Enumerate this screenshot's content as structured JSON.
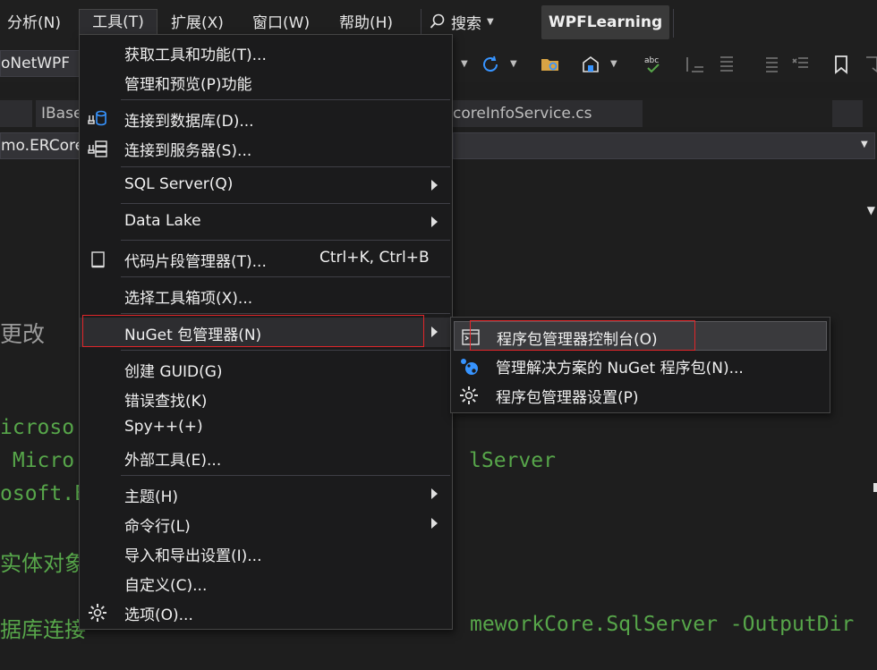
{
  "menubar": {
    "items": [
      "分析(N)",
      "工具(T)",
      "扩展(X)",
      "窗口(W)",
      "帮助(H)"
    ],
    "search_label": "搜索",
    "app_title": "WPFLearning"
  },
  "toolbar": {
    "project_combo": "oNetWPF"
  },
  "tabs": [
    "",
    "IBase",
    "coreInfoService.cs"
  ],
  "navbar": {
    "left_combo": "mo.ERCore"
  },
  "editor": {
    "line_changes": "更改",
    "line_microsoft1": "icroso",
    "line_microsoft2": " Micro",
    "line_sqlserver": "lServer",
    "line_osoft": "osoft.E",
    "line_entity": "实体对象",
    "line_conn_prefix": "据库连接",
    "line_cmd_suffix": "meworkCore.SqlServer -OutputDir"
  },
  "tools_menu": {
    "items": [
      {
        "label": "获取工具和功能(T)...",
        "icon": ""
      },
      {
        "label": "管理和预览(P)功能",
        "icon": ""
      },
      {
        "label": "连接到数据库(D)...",
        "icon": "database-connect-icon"
      },
      {
        "label": "连接到服务器(S)...",
        "icon": "server-connect-icon"
      },
      {
        "label": "SQL Server(Q)",
        "icon": "",
        "submenu": true
      },
      {
        "label": "Data Lake",
        "icon": "",
        "submenu": true
      },
      {
        "label": "代码片段管理器(T)...",
        "shortcut": "Ctrl+K, Ctrl+B",
        "icon": "snippet-icon"
      },
      {
        "label": "选择工具箱项(X)...",
        "icon": ""
      },
      {
        "label": "NuGet 包管理器(N)",
        "icon": "",
        "submenu": true
      },
      {
        "label": "创建 GUID(G)",
        "icon": ""
      },
      {
        "label": "错误查找(K)",
        "icon": ""
      },
      {
        "label": "Spy++(+)",
        "icon": ""
      },
      {
        "label": "外部工具(E)...",
        "icon": ""
      },
      {
        "label": "主题(H)",
        "icon": "",
        "submenu": true
      },
      {
        "label": "命令行(L)",
        "icon": "",
        "submenu": true
      },
      {
        "label": "导入和导出设置(I)...",
        "icon": ""
      },
      {
        "label": "自定义(C)...",
        "icon": ""
      },
      {
        "label": "选项(O)...",
        "icon": "gear-icon"
      }
    ]
  },
  "nuget_submenu": {
    "items": [
      {
        "label": "程序包管理器控制台(O)",
        "icon": "console-icon"
      },
      {
        "label": "管理解决方案的 NuGet 程序包(N)...",
        "icon": "nuget-icon"
      },
      {
        "label": "程序包管理器设置(P)",
        "icon": "gear-icon"
      }
    ]
  },
  "colors": {
    "background": "#1e1e1e",
    "menu_bg": "#1b1b1c",
    "code_green": "#57a64a",
    "highlight_red": "#e0262a",
    "accent_blue": "#3794ff"
  }
}
